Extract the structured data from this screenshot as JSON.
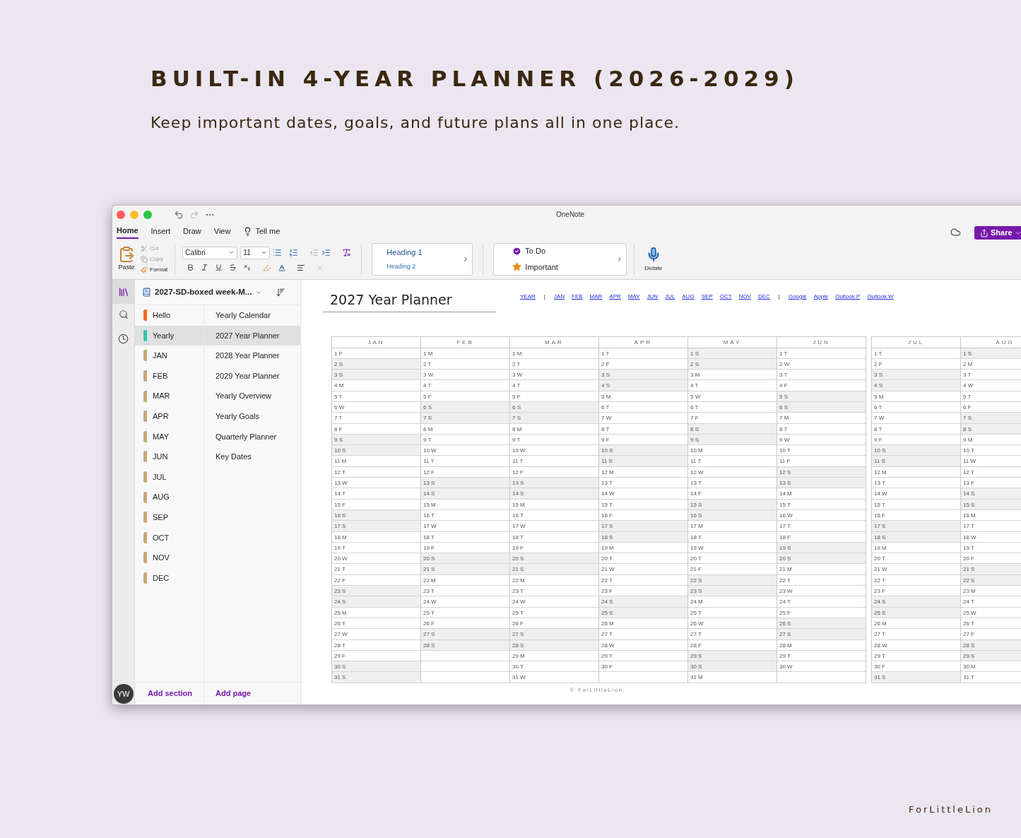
{
  "headline": "BUILT-IN 4-YEAR PLANNER (2026-2029)",
  "subtitle": "Keep important dates, goals, and future plans all in one place.",
  "window": {
    "title": "OneNote"
  },
  "tabs": [
    {
      "label": "Home",
      "selected": true
    },
    {
      "label": "Insert",
      "selected": false
    },
    {
      "label": "Draw",
      "selected": false
    },
    {
      "label": "View",
      "selected": false
    }
  ],
  "tell_me": "Tell me",
  "share": "Share",
  "ribbon": {
    "paste": "Paste",
    "cut": "Cut",
    "copy": "Copy",
    "format": "Format",
    "font": "Calibri",
    "size": "11",
    "styles": [
      "Heading 1",
      "Heading 2"
    ],
    "tags": [
      "To Do",
      "Important"
    ],
    "dictate": "Dictate"
  },
  "notebook": {
    "title": "2027-SD-boxed week-M..."
  },
  "sections": [
    {
      "label": "Hello",
      "color": "#f26b1d",
      "selected": false
    },
    {
      "label": "Yearly",
      "color": "#2ec4b0",
      "selected": true
    },
    {
      "label": "JAN",
      "color": "#c9a679",
      "selected": false
    },
    {
      "label": "FEB",
      "color": "#c9a679",
      "selected": false
    },
    {
      "label": "MAR",
      "color": "#c9a679",
      "selected": false
    },
    {
      "label": "APR",
      "color": "#c9a679",
      "selected": false
    },
    {
      "label": "MAY",
      "color": "#c9a679",
      "selected": false
    },
    {
      "label": "JUN",
      "color": "#c9a679",
      "selected": false
    },
    {
      "label": "JUL",
      "color": "#c9a679",
      "selected": false
    },
    {
      "label": "AUG",
      "color": "#c9a679",
      "selected": false
    },
    {
      "label": "SEP",
      "color": "#c9a679",
      "selected": false
    },
    {
      "label": "OCT",
      "color": "#c9a679",
      "selected": false
    },
    {
      "label": "NOV",
      "color": "#c9a679",
      "selected": false
    },
    {
      "label": "DEC",
      "color": "#c9a679",
      "selected": false
    }
  ],
  "pages": [
    {
      "label": "Yearly Calendar",
      "selected": false
    },
    {
      "label": "2027 Year Planner",
      "selected": true
    },
    {
      "label": "2028 Year Planner",
      "selected": false
    },
    {
      "label": "2029 Year Planner",
      "selected": false
    },
    {
      "label": "Yearly Overview",
      "selected": false
    },
    {
      "label": "Yearly Goals",
      "selected": false
    },
    {
      "label": "Quarterly Planner",
      "selected": false
    },
    {
      "label": "Key Dates",
      "selected": false
    }
  ],
  "add_section": "Add section",
  "add_page": "Add page",
  "user_initials": "YW",
  "page": {
    "title": "2027 Year Planner",
    "nav": [
      {
        "kind": "link",
        "label": "YEAR"
      },
      {
        "kind": "separator",
        "label": "|"
      },
      {
        "kind": "link",
        "label": "JAN"
      },
      {
        "kind": "link",
        "label": "FEB"
      },
      {
        "kind": "link",
        "label": "MAR"
      },
      {
        "kind": "link",
        "label": "APR"
      },
      {
        "kind": "link",
        "label": "MAY"
      },
      {
        "kind": "link",
        "label": "JUN"
      },
      {
        "kind": "link",
        "label": "JUL"
      },
      {
        "kind": "link",
        "label": "AUG"
      },
      {
        "kind": "link",
        "label": "SEP"
      },
      {
        "kind": "link",
        "label": "OCT"
      },
      {
        "kind": "link",
        "label": "NOV"
      },
      {
        "kind": "link",
        "label": "DEC"
      },
      {
        "kind": "separator",
        "label": "|"
      },
      {
        "kind": "link",
        "label": "Google"
      },
      {
        "kind": "link",
        "label": "Apple"
      },
      {
        "kind": "link",
        "label": "Outlook P"
      },
      {
        "kind": "link",
        "label": "Outlook W"
      }
    ],
    "blocks": [
      {
        "months": [
          {
            "label": "JAN",
            "days": [
              {
                "label": "1 F",
                "weekend": false
              },
              {
                "label": "2 S",
                "weekend": true
              },
              {
                "label": "3 S",
                "weekend": true
              },
              {
                "label": "4 M",
                "weekend": false
              },
              {
                "label": "5 T",
                "weekend": false
              },
              {
                "label": "6 W",
                "weekend": false
              },
              {
                "label": "7 T",
                "weekend": false
              },
              {
                "label": "8 F",
                "weekend": false
              },
              {
                "label": "9 S",
                "weekend": true
              },
              {
                "label": "10 S",
                "weekend": true
              },
              {
                "label": "11 M",
                "weekend": false
              },
              {
                "label": "12 T",
                "weekend": false
              },
              {
                "label": "13 W",
                "weekend": false
              },
              {
                "label": "14 T",
                "weekend": false
              },
              {
                "label": "15 F",
                "weekend": false
              },
              {
                "label": "16 S",
                "weekend": true
              },
              {
                "label": "17 S",
                "weekend": true
              },
              {
                "label": "18 M",
                "weekend": false
              },
              {
                "label": "19 T",
                "weekend": false
              },
              {
                "label": "20 W",
                "weekend": false
              },
              {
                "label": "21 T",
                "weekend": false
              },
              {
                "label": "22 F",
                "weekend": false
              },
              {
                "label": "23 S",
                "weekend": true
              },
              {
                "label": "24 S",
                "weekend": true
              },
              {
                "label": "25 M",
                "weekend": false
              },
              {
                "label": "26 T",
                "weekend": false
              },
              {
                "label": "27 W",
                "weekend": false
              },
              {
                "label": "28 T",
                "weekend": false
              },
              {
                "label": "29 F",
                "weekend": false
              },
              {
                "label": "30 S",
                "weekend": true
              },
              {
                "label": "31 S",
                "weekend": true
              }
            ]
          },
          {
            "label": "FEB",
            "days": [
              {
                "label": "1 M",
                "weekend": false
              },
              {
                "label": "2 T",
                "weekend": false
              },
              {
                "label": "3 W",
                "weekend": false
              },
              {
                "label": "4 T",
                "weekend": false
              },
              {
                "label": "5 F",
                "weekend": false
              },
              {
                "label": "6 S",
                "weekend": true
              },
              {
                "label": "7 S",
                "weekend": true
              },
              {
                "label": "8 M",
                "weekend": false
              },
              {
                "label": "9 T",
                "weekend": false
              },
              {
                "label": "10 W",
                "weekend": false
              },
              {
                "label": "11 T",
                "weekend": false
              },
              {
                "label": "12 F",
                "weekend": false
              },
              {
                "label": "13 S",
                "weekend": true
              },
              {
                "label": "14 S",
                "weekend": true
              },
              {
                "label": "15 M",
                "weekend": false
              },
              {
                "label": "16 T",
                "weekend": false
              },
              {
                "label": "17 W",
                "weekend": false
              },
              {
                "label": "18 T",
                "weekend": false
              },
              {
                "label": "19 F",
                "weekend": false
              },
              {
                "label": "20 S",
                "weekend": true
              },
              {
                "label": "21 S",
                "weekend": true
              },
              {
                "label": "22 M",
                "weekend": false
              },
              {
                "label": "23 T",
                "weekend": false
              },
              {
                "label": "24 W",
                "weekend": false
              },
              {
                "label": "25 T",
                "weekend": false
              },
              {
                "label": "26 F",
                "weekend": false
              },
              {
                "label": "27 S",
                "weekend": true
              },
              {
                "label": "28 S",
                "weekend": true
              }
            ]
          },
          {
            "label": "MAR",
            "days": [
              {
                "label": "1 M",
                "weekend": false
              },
              {
                "label": "2 T",
                "weekend": false
              },
              {
                "label": "3 W",
                "weekend": false
              },
              {
                "label": "4 T",
                "weekend": false
              },
              {
                "label": "5 F",
                "weekend": false
              },
              {
                "label": "6 S",
                "weekend": true
              },
              {
                "label": "7 S",
                "weekend": true
              },
              {
                "label": "8 M",
                "weekend": false
              },
              {
                "label": "9 T",
                "weekend": false
              },
              {
                "label": "10 W",
                "weekend": false
              },
              {
                "label": "11 T",
                "weekend": false
              },
              {
                "label": "12 F",
                "weekend": false
              },
              {
                "label": "13 S",
                "weekend": true
              },
              {
                "label": "14 S",
                "weekend": true
              },
              {
                "label": "15 M",
                "weekend": false
              },
              {
                "label": "16 T",
                "weekend": false
              },
              {
                "label": "17 W",
                "weekend": false
              },
              {
                "label": "18 T",
                "weekend": false
              },
              {
                "label": "19 F",
                "weekend": false
              },
              {
                "label": "20 S",
                "weekend": true
              },
              {
                "label": "21 S",
                "weekend": true
              },
              {
                "label": "22 M",
                "weekend": false
              },
              {
                "label": "23 T",
                "weekend": false
              },
              {
                "label": "24 W",
                "weekend": false
              },
              {
                "label": "25 T",
                "weekend": false
              },
              {
                "label": "26 F",
                "weekend": false
              },
              {
                "label": "27 S",
                "weekend": true
              },
              {
                "label": "28 S",
                "weekend": true
              },
              {
                "label": "29 M",
                "weekend": false
              },
              {
                "label": "30 T",
                "weekend": false
              },
              {
                "label": "31 W",
                "weekend": false
              }
            ]
          },
          {
            "label": "APR",
            "days": [
              {
                "label": "1 T",
                "weekend": false
              },
              {
                "label": "2 F",
                "weekend": false
              },
              {
                "label": "3 S",
                "weekend": true
              },
              {
                "label": "4 S",
                "weekend": true
              },
              {
                "label": "5 M",
                "weekend": false
              },
              {
                "label": "6 T",
                "weekend": false
              },
              {
                "label": "7 W",
                "weekend": false
              },
              {
                "label": "8 T",
                "weekend": false
              },
              {
                "label": "9 F",
                "weekend": false
              },
              {
                "label": "10 S",
                "weekend": true
              },
              {
                "label": "11 S",
                "weekend": true
              },
              {
                "label": "12 M",
                "weekend": false
              },
              {
                "label": "13 T",
                "weekend": false
              },
              {
                "label": "14 W",
                "weekend": false
              },
              {
                "label": "15 T",
                "weekend": false
              },
              {
                "label": "16 F",
                "weekend": false
              },
              {
                "label": "17 S",
                "weekend": true
              },
              {
                "label": "18 S",
                "weekend": true
              },
              {
                "label": "19 M",
                "weekend": false
              },
              {
                "label": "20 T",
                "weekend": false
              },
              {
                "label": "21 W",
                "weekend": false
              },
              {
                "label": "22 T",
                "weekend": false
              },
              {
                "label": "23 F",
                "weekend": false
              },
              {
                "label": "24 S",
                "weekend": true
              },
              {
                "label": "25 S",
                "weekend": true
              },
              {
                "label": "26 M",
                "weekend": false
              },
              {
                "label": "27 T",
                "weekend": false
              },
              {
                "label": "28 W",
                "weekend": false
              },
              {
                "label": "29 T",
                "weekend": false
              },
              {
                "label": "30 F",
                "weekend": false
              }
            ]
          },
          {
            "label": "MAY",
            "days": [
              {
                "label": "1 S",
                "weekend": true
              },
              {
                "label": "2 S",
                "weekend": true
              },
              {
                "label": "3 M",
                "weekend": false
              },
              {
                "label": "4 T",
                "weekend": false
              },
              {
                "label": "5 W",
                "weekend": false
              },
              {
                "label": "6 T",
                "weekend": false
              },
              {
                "label": "7 F",
                "weekend": false
              },
              {
                "label": "8 S",
                "weekend": true
              },
              {
                "label": "9 S",
                "weekend": true
              },
              {
                "label": "10 M",
                "weekend": false
              },
              {
                "label": "11 T",
                "weekend": false
              },
              {
                "label": "12 W",
                "weekend": false
              },
              {
                "label": "13 T",
                "weekend": false
              },
              {
                "label": "14 F",
                "weekend": false
              },
              {
                "label": "15 S",
                "weekend": true
              },
              {
                "label": "16 S",
                "weekend": true
              },
              {
                "label": "17 M",
                "weekend": false
              },
              {
                "label": "18 T",
                "weekend": false
              },
              {
                "label": "19 W",
                "weekend": false
              },
              {
                "label": "20 T",
                "weekend": false
              },
              {
                "label": "21 F",
                "weekend": false
              },
              {
                "label": "22 S",
                "weekend": true
              },
              {
                "label": "23 S",
                "weekend": true
              },
              {
                "label": "24 M",
                "weekend": false
              },
              {
                "label": "25 T",
                "weekend": false
              },
              {
                "label": "26 W",
                "weekend": false
              },
              {
                "label": "27 T",
                "weekend": false
              },
              {
                "label": "28 F",
                "weekend": false
              },
              {
                "label": "29 S",
                "weekend": true
              },
              {
                "label": "30 S",
                "weekend": true
              },
              {
                "label": "31 M",
                "weekend": false
              }
            ]
          },
          {
            "label": "JUN",
            "days": [
              {
                "label": "1 T",
                "weekend": false
              },
              {
                "label": "2 W",
                "weekend": false
              },
              {
                "label": "3 T",
                "weekend": false
              },
              {
                "label": "4 F",
                "weekend": false
              },
              {
                "label": "5 S",
                "weekend": true
              },
              {
                "label": "6 S",
                "weekend": true
              },
              {
                "label": "7 M",
                "weekend": false
              },
              {
                "label": "8 T",
                "weekend": false
              },
              {
                "label": "9 W",
                "weekend": false
              },
              {
                "label": "10 T",
                "weekend": false
              },
              {
                "label": "11 F",
                "weekend": false
              },
              {
                "label": "12 S",
                "weekend": true
              },
              {
                "label": "13 S",
                "weekend": true
              },
              {
                "label": "14 M",
                "weekend": false
              },
              {
                "label": "15 T",
                "weekend": false
              },
              {
                "label": "16 W",
                "weekend": false
              },
              {
                "label": "17 T",
                "weekend": false
              },
              {
                "label": "18 F",
                "weekend": false
              },
              {
                "label": "19 S",
                "weekend": true
              },
              {
                "label": "20 S",
                "weekend": true
              },
              {
                "label": "21 M",
                "weekend": false
              },
              {
                "label": "22 T",
                "weekend": false
              },
              {
                "label": "23 W",
                "weekend": false
              },
              {
                "label": "24 T",
                "weekend": false
              },
              {
                "label": "25 F",
                "weekend": false
              },
              {
                "label": "26 S",
                "weekend": true
              },
              {
                "label": "27 S",
                "weekend": true
              },
              {
                "label": "28 M",
                "weekend": false
              },
              {
                "label": "29 T",
                "weekend": false
              },
              {
                "label": "30 W",
                "weekend": false
              }
            ]
          }
        ]
      },
      {
        "months": [
          {
            "label": "JUL",
            "days": [
              {
                "label": "1 T",
                "weekend": false
              },
              {
                "label": "2 F",
                "weekend": false
              },
              {
                "label": "3 S",
                "weekend": true
              },
              {
                "label": "4 S",
                "weekend": true
              },
              {
                "label": "5 M",
                "weekend": false
              },
              {
                "label": "6 T",
                "weekend": false
              },
              {
                "label": "7 W",
                "weekend": false
              },
              {
                "label": "8 T",
                "weekend": false
              },
              {
                "label": "9 F",
                "weekend": false
              },
              {
                "label": "10 S",
                "weekend": true
              },
              {
                "label": "11 S",
                "weekend": true
              },
              {
                "label": "12 M",
                "weekend": false
              },
              {
                "label": "13 T",
                "weekend": false
              },
              {
                "label": "14 W",
                "weekend": false
              },
              {
                "label": "15 T",
                "weekend": false
              },
              {
                "label": "16 F",
                "weekend": false
              },
              {
                "label": "17 S",
                "weekend": true
              },
              {
                "label": "18 S",
                "weekend": true
              },
              {
                "label": "19 M",
                "weekend": false
              },
              {
                "label": "20 T",
                "weekend": false
              },
              {
                "label": "21 W",
                "weekend": false
              },
              {
                "label": "22 T",
                "weekend": false
              },
              {
                "label": "23 F",
                "weekend": false
              },
              {
                "label": "24 S",
                "weekend": true
              },
              {
                "label": "25 S",
                "weekend": true
              },
              {
                "label": "26 M",
                "weekend": false
              },
              {
                "label": "27 T",
                "weekend": false
              },
              {
                "label": "28 W",
                "weekend": false
              },
              {
                "label": "29 T",
                "weekend": false
              },
              {
                "label": "30 F",
                "weekend": false
              },
              {
                "label": "31 S",
                "weekend": true
              }
            ]
          },
          {
            "label": "AUG",
            "days": [
              {
                "label": "1 S",
                "weekend": true
              },
              {
                "label": "2 M",
                "weekend": false
              },
              {
                "label": "3 T",
                "weekend": false
              },
              {
                "label": "4 W",
                "weekend": false
              },
              {
                "label": "5 T",
                "weekend": false
              },
              {
                "label": "6 F",
                "weekend": false
              },
              {
                "label": "7 S",
                "weekend": true
              },
              {
                "label": "8 S",
                "weekend": true
              },
              {
                "label": "9 M",
                "weekend": false
              },
              {
                "label": "10 T",
                "weekend": false
              },
              {
                "label": "11 W",
                "weekend": false
              },
              {
                "label": "12 T",
                "weekend": false
              },
              {
                "label": "13 F",
                "weekend": false
              },
              {
                "label": "14 S",
                "weekend": true
              },
              {
                "label": "15 S",
                "weekend": true
              },
              {
                "label": "16 M",
                "weekend": false
              },
              {
                "label": "17 T",
                "weekend": false
              },
              {
                "label": "18 W",
                "weekend": false
              },
              {
                "label": "19 T",
                "weekend": false
              },
              {
                "label": "20 F",
                "weekend": false
              },
              {
                "label": "21 S",
                "weekend": true
              },
              {
                "label": "22 S",
                "weekend": true
              },
              {
                "label": "23 M",
                "weekend": false
              },
              {
                "label": "24 T",
                "weekend": false
              },
              {
                "label": "25 W",
                "weekend": false
              },
              {
                "label": "26 T",
                "weekend": false
              },
              {
                "label": "27 F",
                "weekend": false
              },
              {
                "label": "28 S",
                "weekend": true
              },
              {
                "label": "29 S",
                "weekend": true
              },
              {
                "label": "30 M",
                "weekend": false
              },
              {
                "label": "31 T",
                "weekend": false
              }
            ]
          }
        ]
      }
    ],
    "credit": "© ForLittleLion."
  },
  "brand": "ForLittleLion"
}
